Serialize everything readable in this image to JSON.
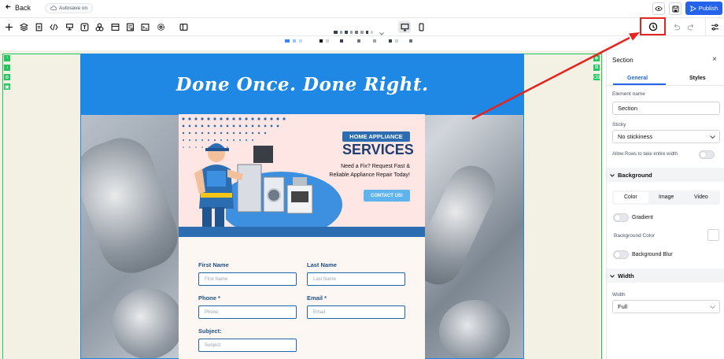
{
  "topbar": {
    "back_label": "Back",
    "autosave_label": "Autosave on",
    "publish_label": "Publish"
  },
  "toolbar": {
    "icons": [
      "plus-icon",
      "layers-icon",
      "page-icon",
      "code-icon",
      "widget-icon",
      "text-icon",
      "shapes-icon",
      "layout-icon",
      "form-icon",
      "terminal-icon",
      "settings-gear-icon",
      "split-view-icon"
    ],
    "device_desktop": "desktop-icon",
    "device_mobile": "mobile-icon",
    "history_icon": "history-clock-icon",
    "undo_icon": "undo-icon",
    "redo_icon": "redo-icon",
    "settings_icon": "sliders-icon"
  },
  "canvas": {
    "headline": "Done Once. Done Right.",
    "banner": {
      "tag": "HOME APPLIANCE",
      "title": "SERVICES",
      "line1": "Need a Fix? Request Fast &",
      "line2": "Reliable Appliance Repair Today!",
      "cta": "CONTACT US!"
    },
    "form": {
      "first_name_label": "First Name",
      "first_name_placeholder": "First Name",
      "last_name_label": "Last Name",
      "last_name_placeholder": "Last Name",
      "phone_label": "Phone *",
      "phone_placeholder": "Phone",
      "email_label": "Email *",
      "email_placeholder": "Email",
      "subject_label": "Subject:",
      "subject_placeholder": "Subject:"
    }
  },
  "panel": {
    "title": "Section",
    "tab_general": "General",
    "tab_styles": "Styles",
    "element_name_label": "Element name",
    "element_name_value": "Section",
    "sticky_label": "Sticky",
    "sticky_value": "No stickiness",
    "allow_rows_label": "Allow Rows to take entire width",
    "background_heading": "Background",
    "bg_tabs": [
      "Color",
      "Image",
      "Video"
    ],
    "gradient_label": "Gradient",
    "bg_color_label": "Background Color",
    "bg_blur_label": "Background Blur",
    "width_heading": "Width",
    "width_label": "Width",
    "width_value": "Full"
  },
  "colors": {
    "accent": "#2563eb",
    "hero_blue": "#1f88e5",
    "guide_green": "#22c55e",
    "annotation_red": "#e5231f",
    "form_label_blue": "#1e4f86"
  }
}
